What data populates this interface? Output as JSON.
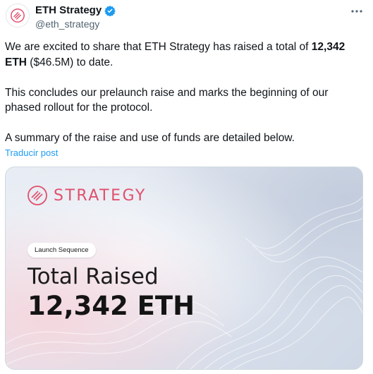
{
  "account": {
    "display_name": "ETH Strategy",
    "handle": "@eth_strategy",
    "avatar_icon": "strategy-logo-icon",
    "verified_icon": "verified-badge-icon",
    "more_icon": "more-options-icon"
  },
  "tweet": {
    "p1_prefix": "We are excited to share that ETH Strategy has raised a total of ",
    "p1_bold": "12,342 ETH",
    "p1_suffix": " ($46.5M) to date.",
    "p2": "This concludes our prelaunch raise and marks the beginning of our phased rollout for the protocol.",
    "p3": "A summary of the raise and use of funds are detailed below."
  },
  "translate_label": "Traducir post",
  "media": {
    "brand": "STRATEGY",
    "badge": "Launch Sequence",
    "title": "Total Raised",
    "amount": "12,342 ETH"
  },
  "colors": {
    "brand_accent": "#e0506d",
    "link": "#1d9bf0",
    "verified": "#1d9bf0",
    "secondary_text": "#536471"
  }
}
